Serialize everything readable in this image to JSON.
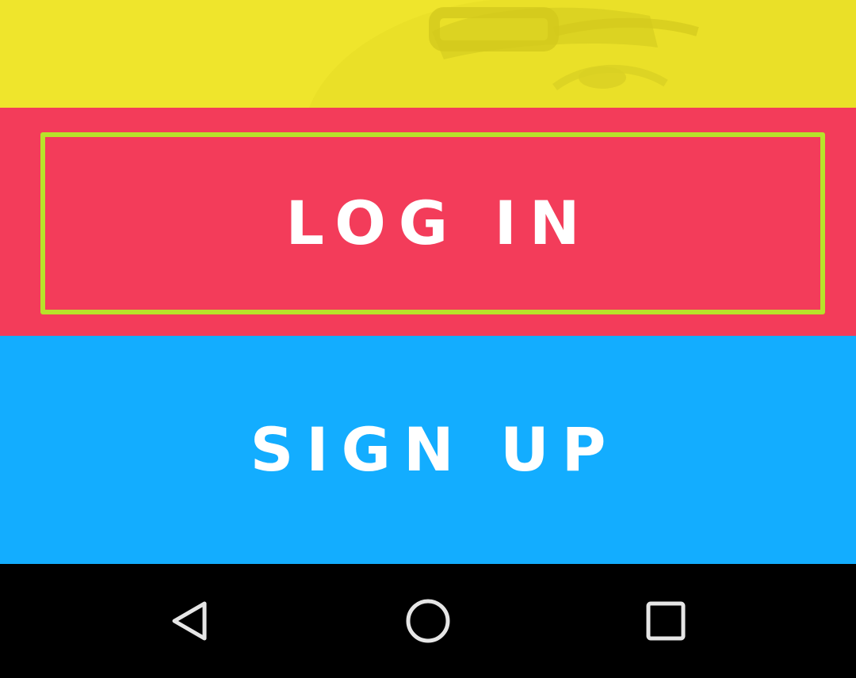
{
  "login": {
    "label": "LOG IN"
  },
  "signup": {
    "label": "SIGN UP"
  },
  "navbar": {
    "back_icon": "back-triangle-icon",
    "home_icon": "home-circle-icon",
    "recents_icon": "recents-square-icon"
  },
  "colors": {
    "hero_yellow": "#efe52c",
    "login_red": "#f33c5a",
    "login_border": "#b7e22a",
    "signup_blue": "#13adff",
    "navbar_black": "#000000",
    "nav_icon": "#e6e6e6"
  }
}
